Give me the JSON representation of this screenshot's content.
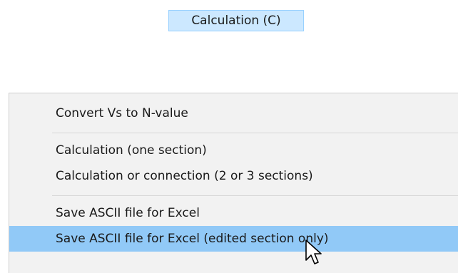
{
  "menubar": {
    "active_menu_label": "Calculation (C)"
  },
  "menu": {
    "items": [
      {
        "label": "Convert Vs to N-value",
        "highlighted": false
      },
      {
        "label": "Calculation (one section)",
        "highlighted": false
      },
      {
        "label": "Calculation or connection (2 or 3 sections)",
        "highlighted": false
      },
      {
        "label": "Save ASCII file for Excel",
        "highlighted": false
      },
      {
        "label": "Save ASCII file for Excel (edited section only)",
        "highlighted": true
      }
    ]
  },
  "colors": {
    "menubar_active_bg": "#cce8ff",
    "menu_bg": "#f2f2f2",
    "menu_highlight_bg": "#91c9f7"
  },
  "cursor": {
    "icon": "mouse-pointer-icon"
  }
}
